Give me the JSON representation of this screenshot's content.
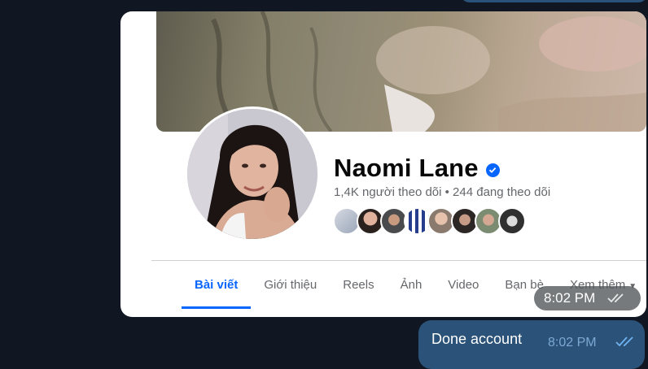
{
  "profile": {
    "name": "Naomi Lane",
    "stats": "1,4K người theo dõi • 244 đang theo dõi"
  },
  "tabs": [
    {
      "label": "Bài viết",
      "active": true
    },
    {
      "label": "Giới thiệu",
      "active": false
    },
    {
      "label": "Reels",
      "active": false
    },
    {
      "label": "Ảnh",
      "active": false
    },
    {
      "label": "Video",
      "active": false
    },
    {
      "label": "Bạn bè",
      "active": false
    },
    {
      "label": "Xem thêm",
      "active": false
    }
  ],
  "photo_message": {
    "time": "8:02 PM",
    "status_icon": "double-check-icon"
  },
  "reply_message": {
    "text": "Done account",
    "time": "8:02 PM",
    "status_icon": "double-check-icon"
  },
  "colors": {
    "accent": "#0866ff",
    "chat_background": "#101722",
    "outgoing_bubble": "#2b5278"
  }
}
